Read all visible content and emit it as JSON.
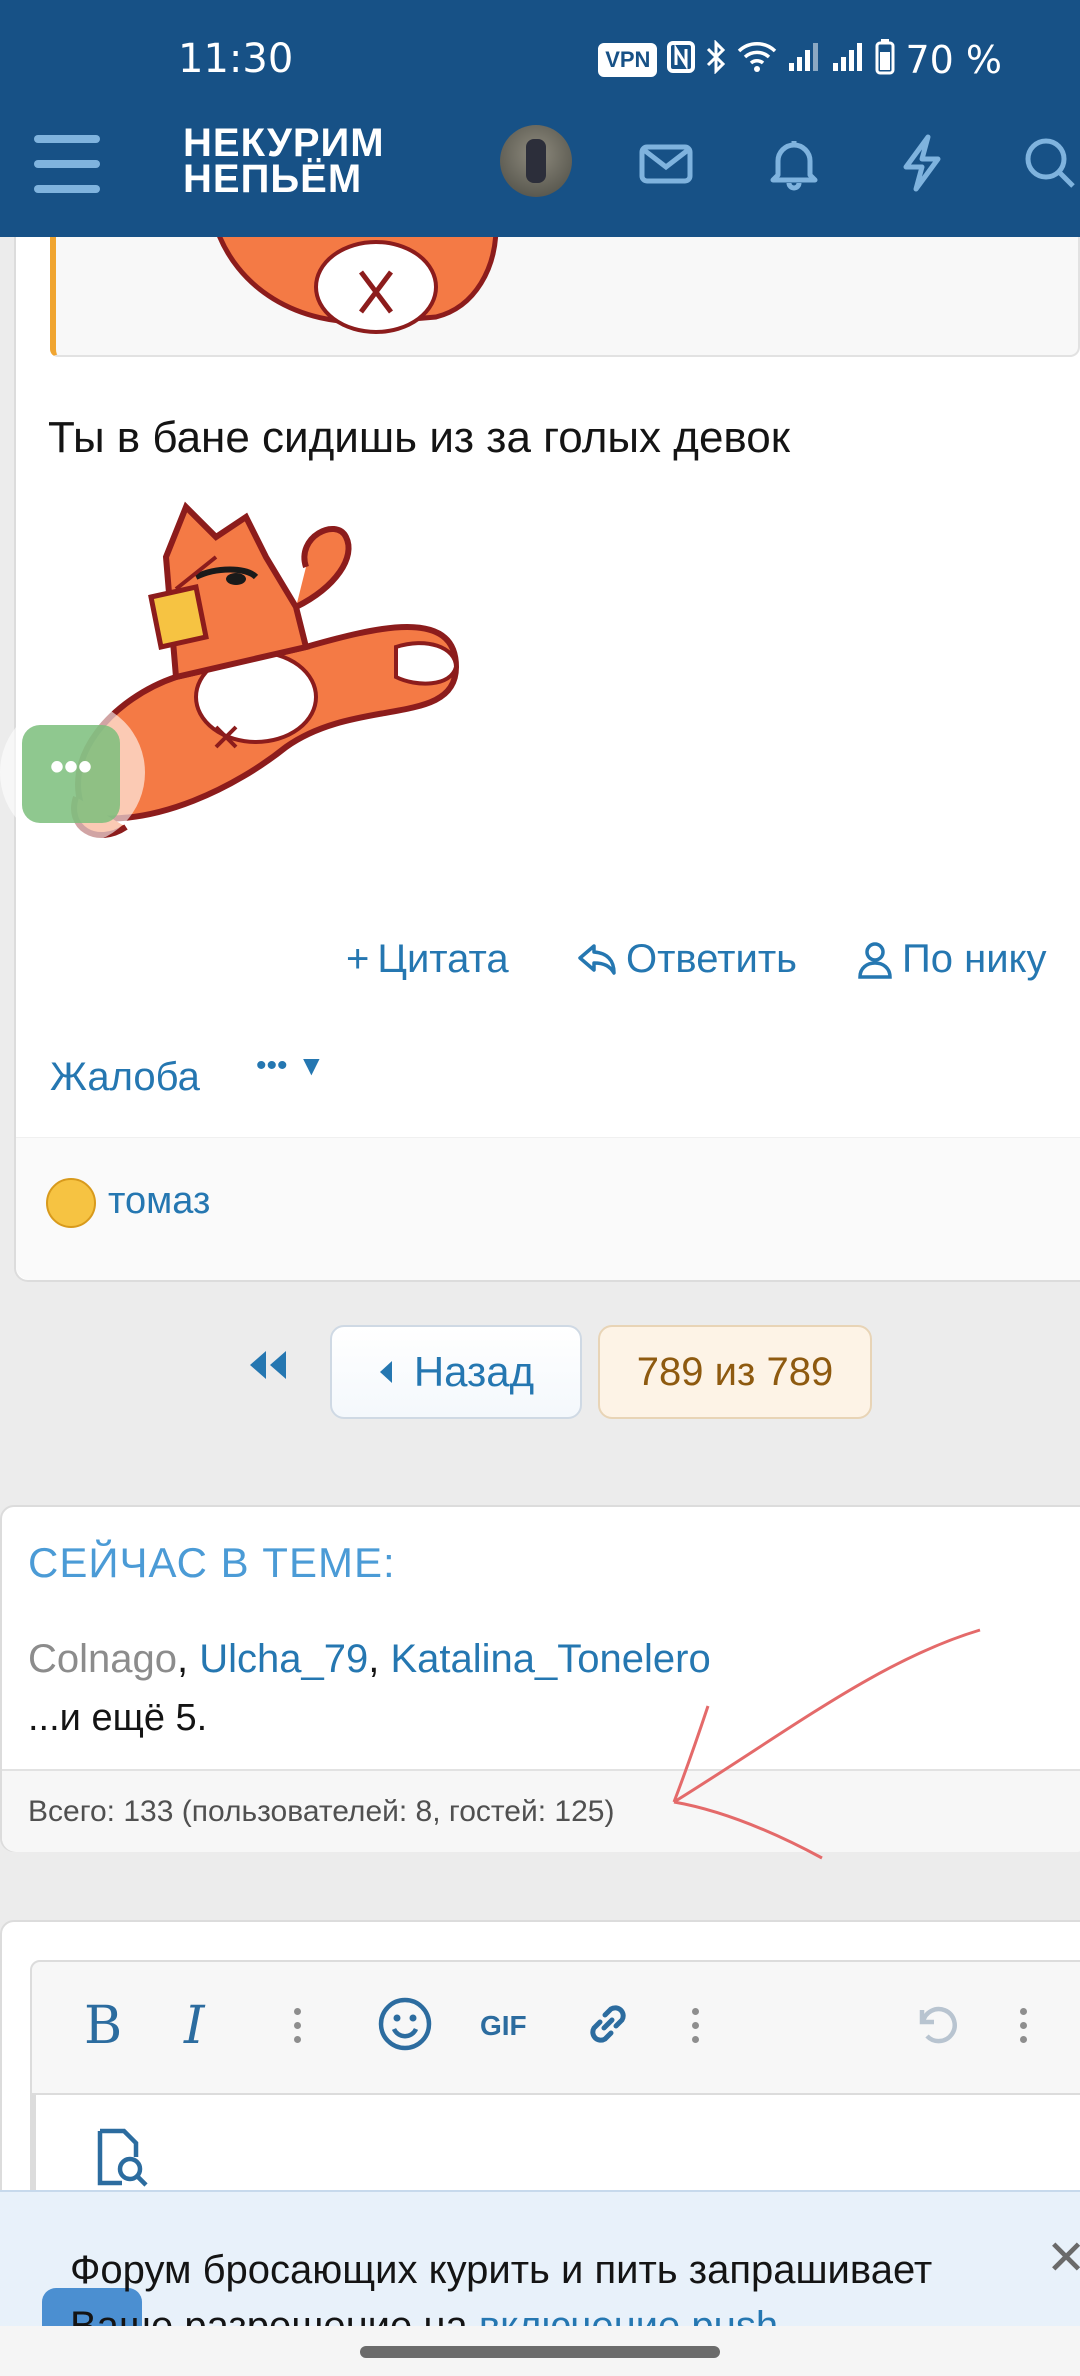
{
  "status_bar": {
    "time": "11:30",
    "vpn": "VPN",
    "battery": "70 %",
    "icons": [
      "nfc-icon",
      "bluetooth-icon",
      "wifi-icon",
      "signal-icon",
      "signal-icon",
      "battery-icon"
    ]
  },
  "header": {
    "logo_line1": "НЕКУРИМ",
    "logo_line2": "НЕПЬЁМ",
    "icons": [
      "menu-icon",
      "avatar",
      "mail-icon",
      "bell-icon",
      "bolt-icon",
      "search-icon"
    ]
  },
  "post": {
    "text": "Ты в бане сидишь из за голых девок",
    "actions": {
      "quote": "Цитата",
      "reply": "Ответить",
      "by_nick": "По нику",
      "report": "Жалоба",
      "more": "•••"
    },
    "reaction_user": "томаз"
  },
  "floating_button": {
    "label": "•••"
  },
  "pagination": {
    "back": "Назад",
    "current": "789 из 789"
  },
  "now_in_thread": {
    "title": "СЕЙЧАС В ТЕМЕ:",
    "users": [
      "Colnago",
      "Ulcha_79",
      "Katalina_Tonelero"
    ],
    "more": "...и ещё 5.",
    "total": "Всего: 133 (пользователей: 8, гостей: 125)"
  },
  "editor": {
    "tools": [
      "bold-icon",
      "italic-icon",
      "more-icon",
      "emoji-icon",
      "gif-icon",
      "link-icon",
      "more-icon",
      "undo-icon",
      "more-icon",
      "preview-icon"
    ],
    "gif_label": "GIF"
  },
  "push_banner": {
    "text": "Форум бросающих курить и пить запрашивает Ваше разрешение на ",
    "link": "включение push-"
  },
  "colors": {
    "header_bg": "#175186",
    "link": "#2577b1",
    "accent_orange": "#f0a531"
  }
}
